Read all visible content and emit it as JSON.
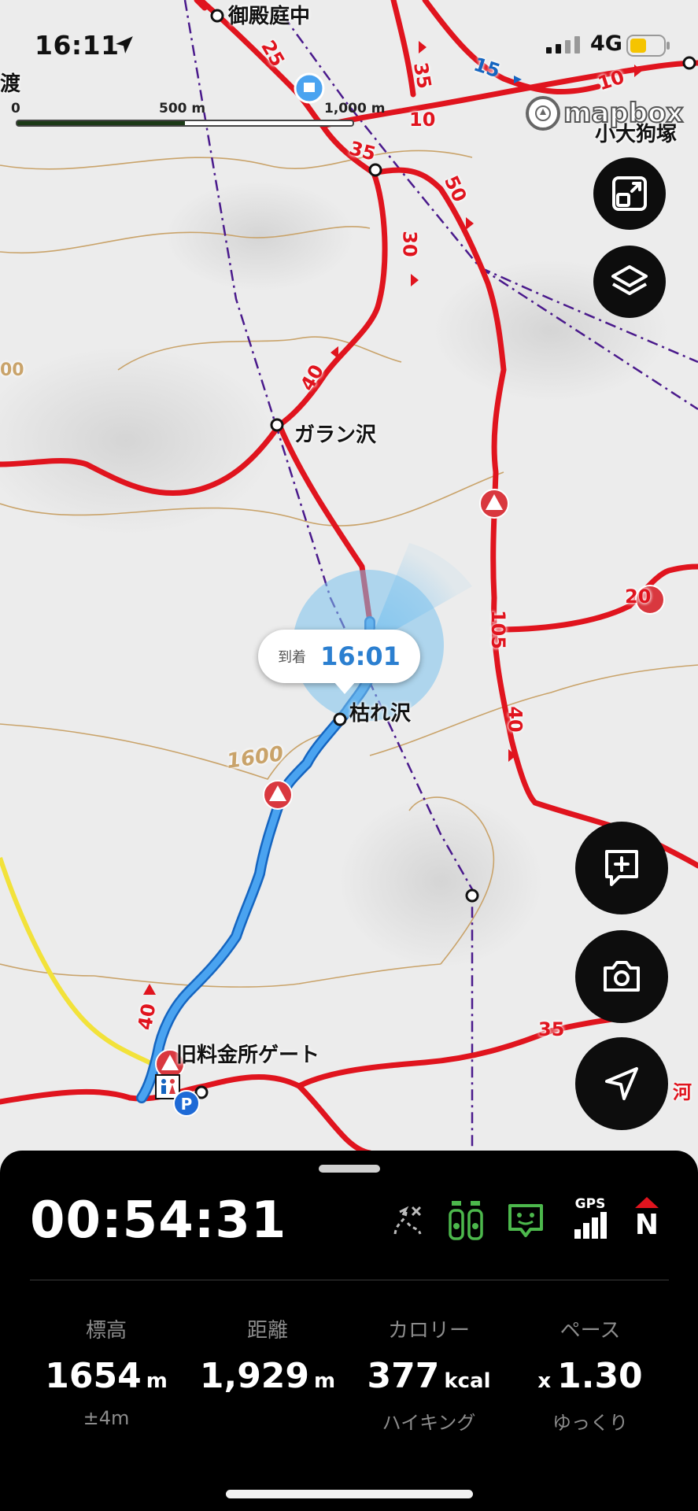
{
  "status_bar": {
    "time": "16:11",
    "network": "4G"
  },
  "scale_bar": {
    "labels": [
      "0",
      "500 m",
      "1,000 m"
    ]
  },
  "attribution": "mapbox",
  "map_labels": {
    "places": [
      "御殿庭中",
      "小大狗塚",
      "ガラン沢",
      "枯れ沢",
      "旧料金所ゲート"
    ],
    "partial": [
      "渡",
      "00",
      "河"
    ],
    "contour": "1600",
    "course_times": [
      "25",
      "15",
      "35",
      "10",
      "10",
      "35",
      "50",
      "30",
      "40",
      "20",
      "105",
      "40",
      "40",
      "35"
    ]
  },
  "arrival_callout": {
    "label": "到着",
    "time": "16:01"
  },
  "bottom_panel": {
    "elapsed": "00:54:31",
    "gps_label": "GPS",
    "compass_label": "N",
    "stats": [
      {
        "label": "標高",
        "value": "1654",
        "unit": "m",
        "sub": "±4m"
      },
      {
        "label": "距離",
        "value": "1,929",
        "unit": "m",
        "sub": ""
      },
      {
        "label": "カロリー",
        "value": "377",
        "unit": "kcal",
        "sub": "ハイキング"
      },
      {
        "label": "ペース",
        "prefix": "x",
        "value": "1.30",
        "unit": "",
        "sub": "ゆっくり"
      }
    ]
  },
  "colors": {
    "trail": "#e0141e",
    "track": "#3a8ee0",
    "boundary": "#4a1a8c",
    "contour": "#c9a36a",
    "road": "#f2e23a"
  },
  "icons": [
    "location-arrow-icon",
    "signal-icon",
    "battery-icon",
    "zoom-extent-icon",
    "layers-icon",
    "add-memo-icon",
    "camera-icon",
    "navigate-icon",
    "route-toggle-icon",
    "companion-icon",
    "chat-icon",
    "gps-signal-icon",
    "compass-icon",
    "warning-icon",
    "toilet-icon",
    "parking-icon"
  ]
}
